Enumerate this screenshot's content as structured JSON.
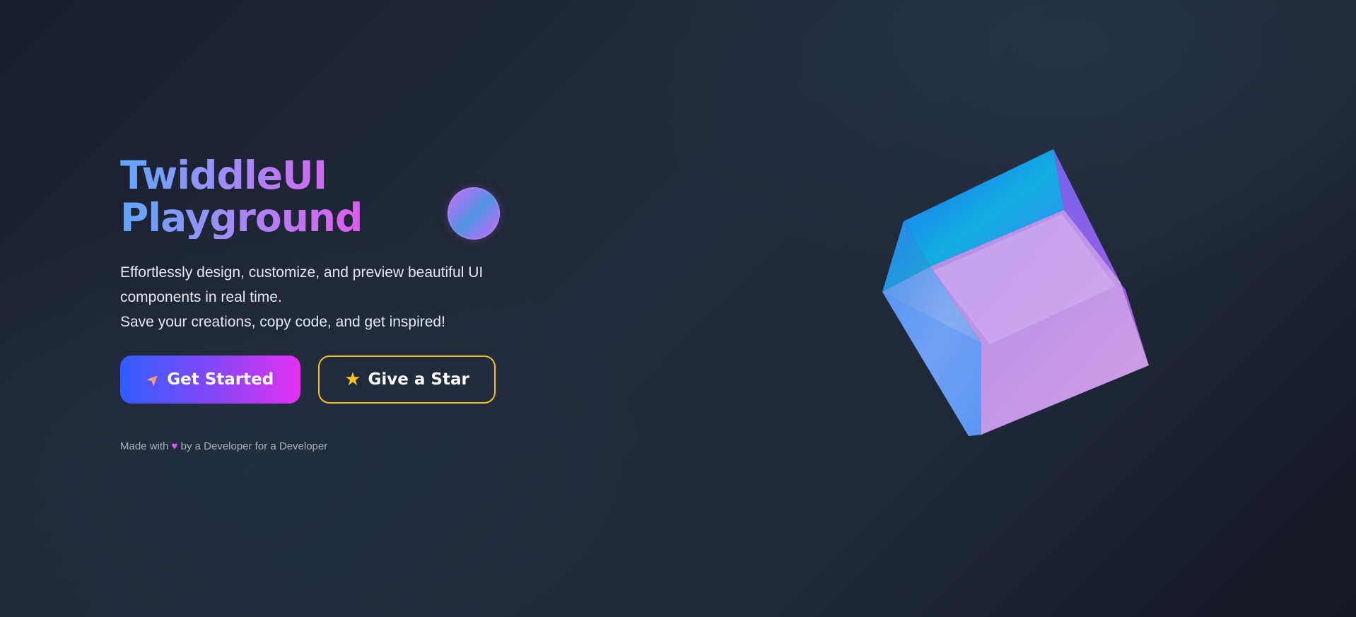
{
  "hero": {
    "title_line1": "TwiddleUI",
    "title_line2": "Playground",
    "subtitle_line1": "Effortlessly design, customize, and preview beautiful UI components in real time.",
    "subtitle_line2": "Save your creations, copy code, and get inspired!"
  },
  "buttons": {
    "get_started": {
      "label": "Get Started",
      "icon": "rocket-icon"
    },
    "give_star": {
      "label": "Give a Star",
      "icon": "star-icon"
    }
  },
  "footer": {
    "prefix": "Made with",
    "heart_icon": "heart-icon",
    "suffix": "by a Developer for a Developer"
  },
  "colors": {
    "title_gradient_start": "#5fa6ff",
    "title_gradient_end": "#e05cf0",
    "primary_button_start": "#2f5dff",
    "primary_button_end": "#e331f2",
    "secondary_button_border": "#f0c419",
    "background": "#1f2636"
  },
  "decorations": {
    "orb": "gradient-orb",
    "cube": "glass-cube-illustration"
  }
}
